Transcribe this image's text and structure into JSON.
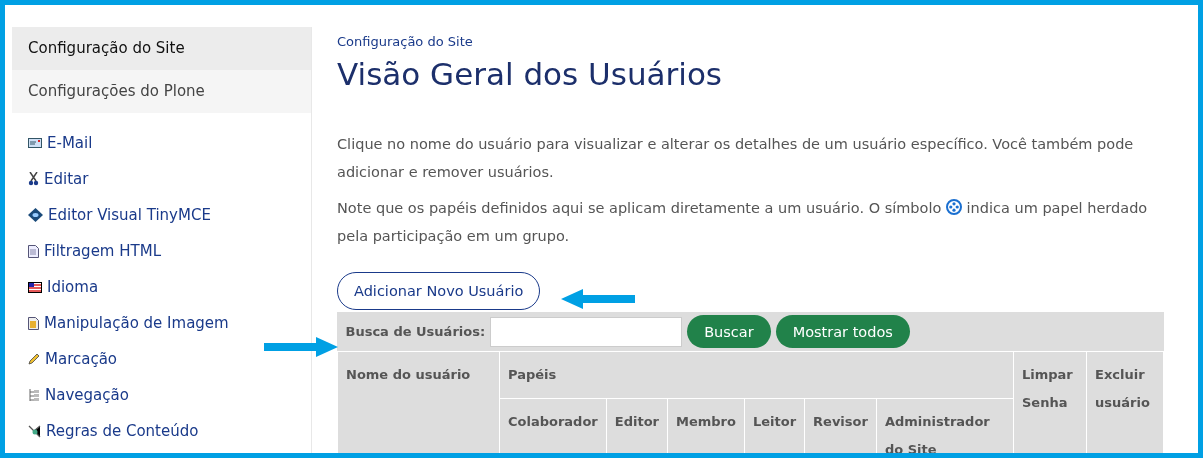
{
  "sidebar": {
    "header": "Configuração do Site",
    "section": "Configurações do Plone",
    "items": [
      {
        "label": "E-Mail"
      },
      {
        "label": "Editar"
      },
      {
        "label": "Editor Visual TinyMCE"
      },
      {
        "label": "Filtragem HTML"
      },
      {
        "label": "Idioma"
      },
      {
        "label": "Manipulação de Imagem"
      },
      {
        "label": "Marcação"
      },
      {
        "label": "Navegação"
      },
      {
        "label": "Regras de Conteúdo"
      }
    ]
  },
  "breadcrumb": "Configuração do Site",
  "title": "Visão Geral dos Usuários",
  "intro": "Clique no nome do usuário para visualizar e alterar os detalhes de um usuário específico. Você também pode adicionar e remover usuários.",
  "note_before": "Note que os papéis definidos aqui se aplicam diretamente a um usuário. O símbolo",
  "note_after": [
    "indica um papel herdado",
    "pela participação em um grupo."
  ],
  "add_button": "Adicionar Novo Usuário",
  "search": {
    "label": "Busca de Usuários:",
    "buttons": [
      "Buscar",
      "Mostrar todos"
    ]
  },
  "table": {
    "user_column": "Nome do usuário",
    "roles_header": "Papéis",
    "roles": [
      "Colaborador",
      "Editor",
      "Membro",
      "Leitor",
      "Revisor",
      "Administrador do Site"
    ],
    "reset_column": "Limpar Senha",
    "delete_column": "Excluir usuário"
  }
}
